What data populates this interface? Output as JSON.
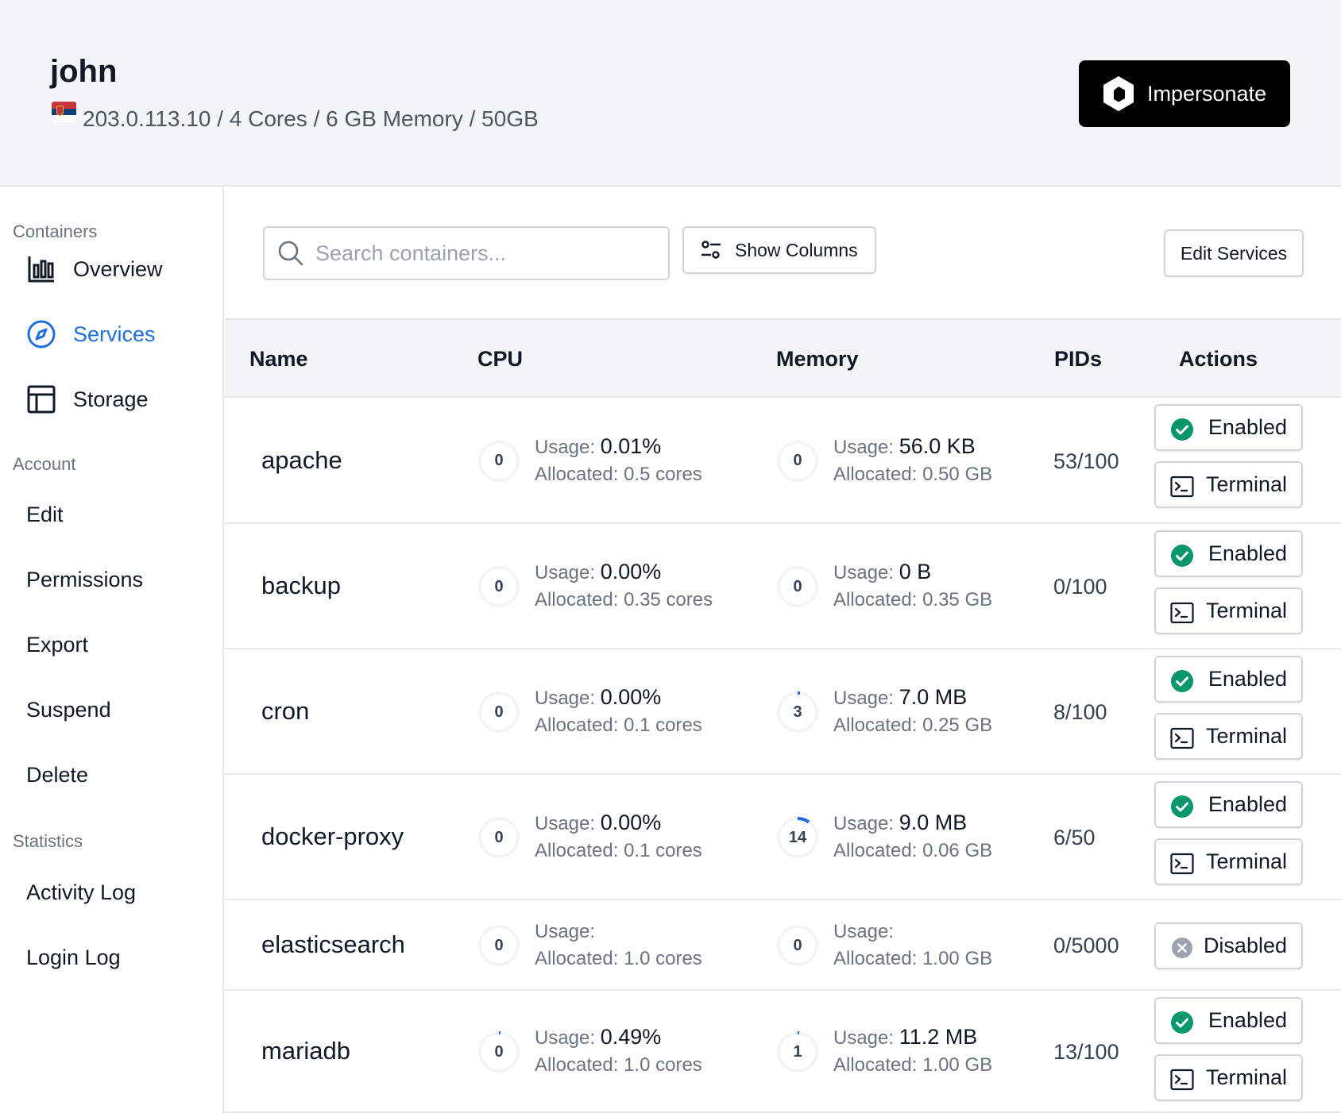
{
  "header": {
    "user_name": "john",
    "server_info": "203.0.113.10 / 4 Cores / 6 GB Memory / 50GB",
    "impersonate_label": "Impersonate"
  },
  "sidebar": {
    "containers_label": "Containers",
    "nav": [
      {
        "label": "Overview",
        "icon": "bar-chart-icon"
      },
      {
        "label": "Services",
        "icon": "compass-icon",
        "active": true
      },
      {
        "label": "Storage",
        "icon": "table-layout-icon"
      }
    ],
    "account_label": "Account",
    "account_items": [
      "Edit",
      "Permissions",
      "Export",
      "Suspend",
      "Delete"
    ],
    "statistics_label": "Statistics",
    "statistics_items": [
      "Activity Log",
      "Login Log"
    ]
  },
  "toolbar": {
    "search_placeholder": "Search containers...",
    "show_columns_label": "Show Columns",
    "edit_services_label": "Edit Services"
  },
  "table": {
    "columns": [
      "Name",
      "CPU",
      "Memory",
      "PIDs",
      "Actions"
    ],
    "usage_label": "Usage:",
    "rows": [
      {
        "name": "apache",
        "cpu_gauge": "0",
        "cpu_usage": "0.01%",
        "cpu_allocated": "Allocated: 0.5 cores",
        "mem_gauge": "0",
        "mem_usage": "56.0 KB",
        "mem_allocated": "Allocated: 0.50 GB",
        "pids": "53/100",
        "status": "Enabled",
        "terminal": "Terminal"
      },
      {
        "name": "backup",
        "cpu_gauge": "0",
        "cpu_usage": "0.00%",
        "cpu_allocated": "Allocated: 0.35 cores",
        "mem_gauge": "0",
        "mem_usage": "0 B",
        "mem_allocated": "Allocated: 0.35 GB",
        "pids": "0/100",
        "status": "Enabled",
        "terminal": "Terminal"
      },
      {
        "name": "cron",
        "cpu_gauge": "0",
        "cpu_usage": "0.00%",
        "cpu_allocated": "Allocated: 0.1 cores",
        "mem_gauge": "3",
        "mem_usage": "7.0 MB",
        "mem_allocated": "Allocated: 0.25 GB",
        "pids": "8/100",
        "status": "Enabled",
        "terminal": "Terminal"
      },
      {
        "name": "docker-proxy",
        "cpu_gauge": "0",
        "cpu_usage": "0.00%",
        "cpu_allocated": "Allocated: 0.1 cores",
        "mem_gauge": "14",
        "mem_usage": "9.0 MB",
        "mem_allocated": "Allocated: 0.06 GB",
        "pids": "6/50",
        "status": "Enabled",
        "terminal": "Terminal"
      },
      {
        "name": "elasticsearch",
        "cpu_gauge": "0",
        "cpu_usage": "",
        "cpu_allocated": "Allocated: 1.0 cores",
        "mem_gauge": "0",
        "mem_usage": "",
        "mem_allocated": "Allocated: 1.00 GB",
        "pids": "0/5000",
        "status": "Disabled",
        "terminal": ""
      },
      {
        "name": "mariadb",
        "cpu_gauge": "0",
        "cpu_usage": "0.49%",
        "cpu_allocated": "Allocated: 1.0 cores",
        "mem_gauge": "1",
        "mem_usage": "11.2 MB",
        "mem_allocated": "Allocated: 1.00 GB",
        "pids": "13/100",
        "status": "Enabled",
        "terminal": "Terminal"
      }
    ]
  },
  "colors": {
    "accent": "#1d6fe0",
    "enabled": "#059669",
    "disabled": "#9ca3af",
    "gauge_track": "#f3f4f6",
    "gauge_fill": "#2563eb"
  }
}
